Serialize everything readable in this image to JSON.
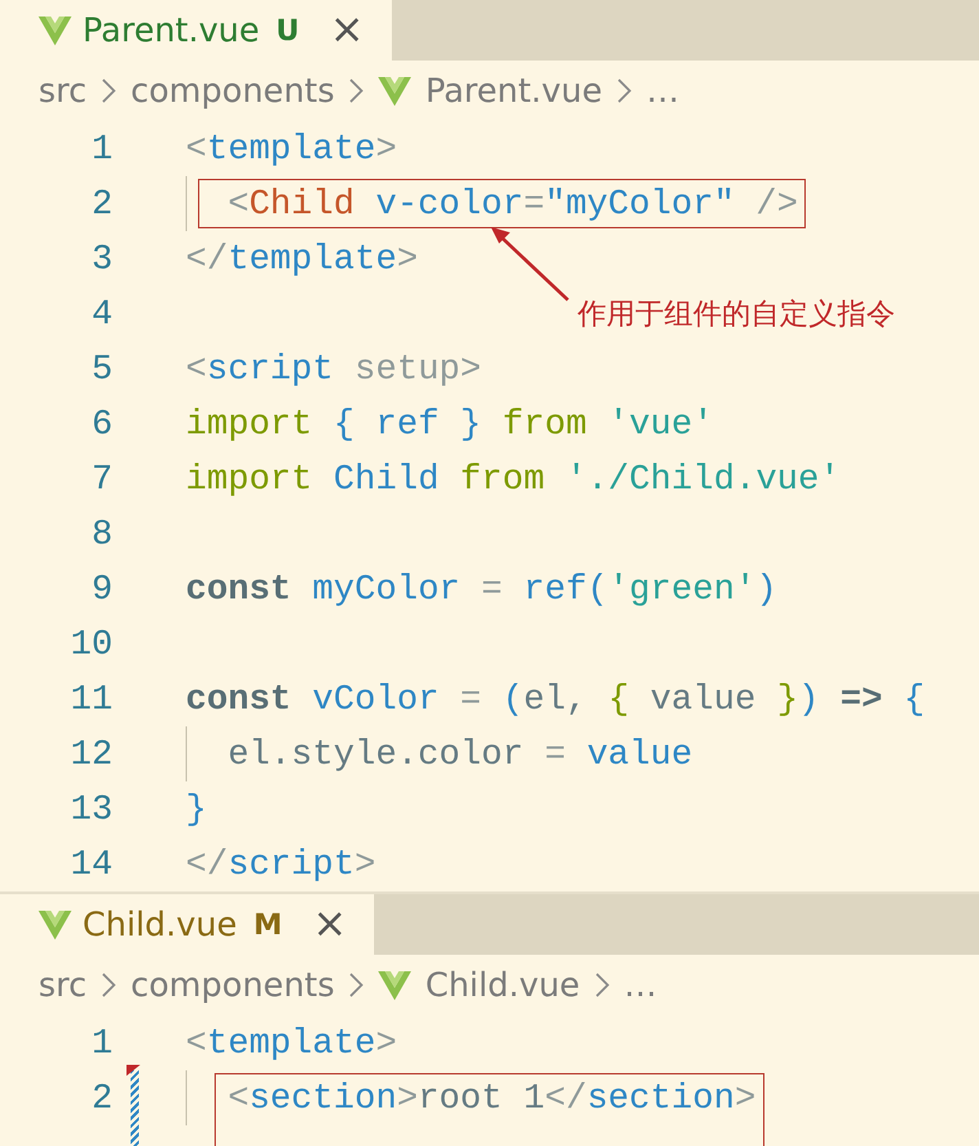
{
  "panes": [
    {
      "tabs": [
        {
          "label": "Parent.vue",
          "status": "U",
          "color": "#2e7d32",
          "close": "×",
          "selected": true
        }
      ],
      "breadcrumb": [
        {
          "kind": "folder",
          "text": "src"
        },
        {
          "kind": "folder",
          "text": "components"
        },
        {
          "kind": "file",
          "text": "Parent.vue"
        },
        {
          "kind": "more",
          "text": "…"
        }
      ],
      "lines": [
        {
          "number": "1",
          "boxed": false,
          "tokens": [
            {
              "kind": "punct",
              "text": "<"
            },
            {
              "kind": "tag",
              "text": "template"
            },
            {
              "kind": "punct",
              "text": ">"
            }
          ]
        },
        {
          "number": "2",
          "boxed": true,
          "tokens": [
            {
              "kind": "punct",
              "text": "  <"
            },
            {
              "kind": "component",
              "text": "Child"
            },
            {
              "kind": "attr",
              "text": " v-color"
            },
            {
              "kind": "punct",
              "text": "="
            },
            {
              "kind": "string2",
              "text": "\"myColor\""
            },
            {
              "kind": "punct",
              "text": " />"
            }
          ]
        },
        {
          "number": "3",
          "boxed": false,
          "tokens": [
            {
              "kind": "punct",
              "text": "</"
            },
            {
              "kind": "tag",
              "text": "template"
            },
            {
              "kind": "punct",
              "text": ">"
            }
          ]
        },
        {
          "number": "4",
          "boxed": false
        },
        {
          "number": "5",
          "boxed": false,
          "tokens": [
            {
              "kind": "punct",
              "text": "<"
            },
            {
              "kind": "tag",
              "text": "script"
            },
            {
              "kind": "punct",
              "text": " setup>"
            }
          ]
        },
        {
          "number": "6",
          "boxed": false,
          "tokens": [
            {
              "kind": "keyword",
              "text": "import"
            },
            {
              "kind": "bracket",
              "text": " {"
            },
            {
              "kind": "variable",
              "text": " ref "
            },
            {
              "kind": "bracket",
              "text": "}"
            },
            {
              "kind": "keyword",
              "text": " from"
            },
            {
              "kind": "string",
              "text": " 'vue'"
            }
          ]
        },
        {
          "number": "7",
          "boxed": false,
          "tokens": [
            {
              "kind": "keyword",
              "text": "import"
            },
            {
              "kind": "variable",
              "text": " Child"
            },
            {
              "kind": "keyword",
              "text": " from"
            },
            {
              "kind": "string",
              "text": " './Child.vue'"
            }
          ]
        },
        {
          "number": "8",
          "boxed": false
        },
        {
          "number": "9",
          "boxed": false,
          "tokens": [
            {
              "kind": "storage",
              "text": "const"
            },
            {
              "kind": "variable",
              "text": " myColor"
            },
            {
              "kind": "punct",
              "text": " = "
            },
            {
              "kind": "variable",
              "text": "ref"
            },
            {
              "kind": "bracket",
              "text": "("
            },
            {
              "kind": "string",
              "text": "'green'"
            },
            {
              "kind": "bracket",
              "text": ")"
            }
          ]
        },
        {
          "number": "10",
          "boxed": false
        },
        {
          "number": "11",
          "boxed": false,
          "tokens": [
            {
              "kind": "storage",
              "text": "const"
            },
            {
              "kind": "variable",
              "text": " vColor"
            },
            {
              "kind": "punct",
              "text": " = "
            },
            {
              "kind": "bracket",
              "text": "("
            },
            {
              "kind": "plain",
              "text": "el, "
            },
            {
              "kind": "keyword",
              "text": "{"
            },
            {
              "kind": "plain",
              "text": " value "
            },
            {
              "kind": "keyword",
              "text": "}"
            },
            {
              "kind": "bracket",
              "text": ")"
            },
            {
              "kind": "storage",
              "text": " =>"
            },
            {
              "kind": "bracket",
              "text": " {"
            }
          ]
        },
        {
          "number": "12",
          "boxed": false,
          "tokens": [
            {
              "kind": "plain",
              "text": "  el.style.color "
            },
            {
              "kind": "punct",
              "text": "= "
            },
            {
              "kind": "variable",
              "text": "value"
            }
          ]
        },
        {
          "number": "13",
          "boxed": false,
          "tokens": [
            {
              "kind": "bracket",
              "text": "}"
            }
          ]
        },
        {
          "number": "14",
          "boxed": false,
          "tokens": [
            {
              "kind": "punct",
              "text": "</"
            },
            {
              "kind": "tag",
              "text": "script"
            },
            {
              "kind": "punct",
              "text": ">"
            }
          ]
        }
      ],
      "annotation": {
        "text": "作用于组件的自定义指令"
      }
    },
    {
      "tabs": [
        {
          "label": "Child.vue",
          "status": "M",
          "color": "#8a6a14",
          "close": "×",
          "selected": true
        }
      ],
      "breadcrumb": [
        {
          "kind": "folder",
          "text": "src"
        },
        {
          "kind": "folder",
          "text": "components"
        },
        {
          "kind": "file",
          "text": "Child.vue"
        },
        {
          "kind": "more",
          "text": "…"
        }
      ],
      "lines": [
        {
          "number": "1",
          "boxed": false,
          "modified": false,
          "deleted_above": false,
          "tokens": [
            {
              "kind": "punct",
              "text": "<"
            },
            {
              "kind": "tag",
              "text": "template"
            },
            {
              "kind": "punct",
              "text": ">"
            }
          ]
        },
        {
          "number": "2",
          "boxed": true,
          "modified": true,
          "deleted_above": true,
          "tokens": [
            {
              "kind": "punct",
              "text": "  <"
            },
            {
              "kind": "tag",
              "text": "section"
            },
            {
              "kind": "punct",
              "text": ">"
            },
            {
              "kind": "plain",
              "text": "root 1"
            },
            {
              "kind": "punct",
              "text": "</"
            },
            {
              "kind": "tag",
              "text": "section"
            },
            {
              "kind": "punct",
              "text": ">"
            }
          ]
        }
      ]
    }
  ]
}
